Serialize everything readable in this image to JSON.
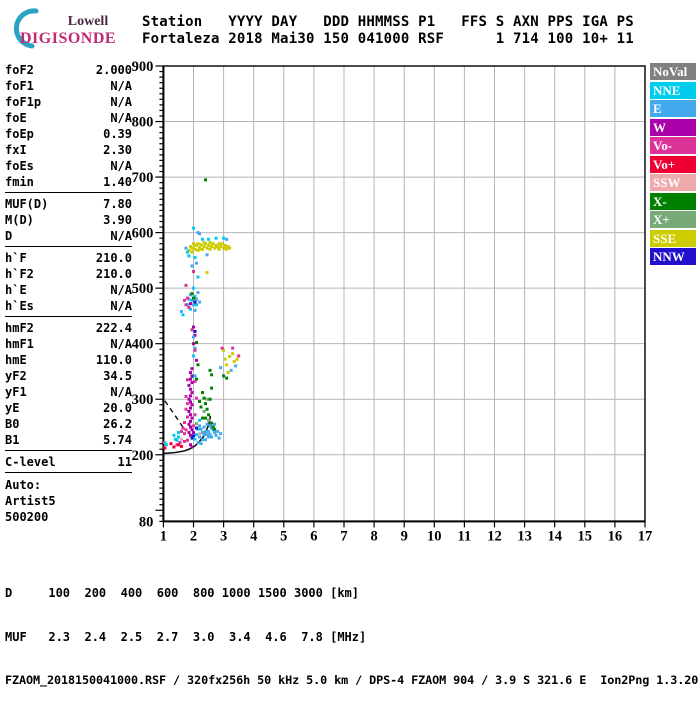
{
  "logo": {
    "top": "Lowell",
    "bottom": "DIGISONDE"
  },
  "header": {
    "line1": "Station   YYYY DAY   DDD HHMMSS P1   FFS S AXN PPS IGA PS",
    "line2": "Fortaleza 2018 Mai30 150 041000 RSF      1 714 100 10+ 11"
  },
  "params": [
    {
      "label": "foF2",
      "value": "2.000"
    },
    {
      "label": "foF1",
      "value": "N/A"
    },
    {
      "label": "foF1p",
      "value": "N/A"
    },
    {
      "label": "foE",
      "value": "N/A"
    },
    {
      "label": "foEp",
      "value": "0.39"
    },
    {
      "label": "fxI",
      "value": "2.30"
    },
    {
      "label": "foEs",
      "value": "N/A"
    },
    {
      "label": "fmin",
      "value": "1.40"
    },
    {
      "sep": true
    },
    {
      "label": "MUF(D)",
      "value": "7.80"
    },
    {
      "label": "M(D)",
      "value": "3.90"
    },
    {
      "label": "D",
      "value": "N/A"
    },
    {
      "sep": true
    },
    {
      "label": "h`F",
      "value": "210.0"
    },
    {
      "label": "h`F2",
      "value": "210.0"
    },
    {
      "label": "h`E",
      "value": "N/A"
    },
    {
      "label": "h`Es",
      "value": "N/A"
    },
    {
      "sep": true
    },
    {
      "label": "hmF2",
      "value": "222.4"
    },
    {
      "label": "hmF1",
      "value": "N/A"
    },
    {
      "label": "hmE",
      "value": "110.0"
    },
    {
      "label": "yF2",
      "value": "34.5"
    },
    {
      "label": "yF1",
      "value": "N/A"
    },
    {
      "label": "yE",
      "value": "20.0"
    },
    {
      "label": "B0",
      "value": "26.2"
    },
    {
      "label": "B1",
      "value": "5.74"
    },
    {
      "sep": true
    },
    {
      "label": "C-level",
      "value": "11"
    },
    {
      "sep": true
    }
  ],
  "auto_block": [
    "Auto:",
    "Artist5",
    "500200"
  ],
  "legend": [
    {
      "label": "NoVal",
      "color": "#808080"
    },
    {
      "label": "NNE",
      "color": "#00ccee"
    },
    {
      "label": "E",
      "color": "#44aaee"
    },
    {
      "label": "W",
      "color": "#aa00aa"
    },
    {
      "label": "Vo-",
      "color": "#dd3399"
    },
    {
      "label": "Vo+",
      "color": "#ee0033"
    },
    {
      "label": "SSW",
      "color": "#eeaaaa"
    },
    {
      "label": "X-",
      "color": "#008000"
    },
    {
      "label": "X+",
      "color": "#77aa77"
    },
    {
      "label": "SSE",
      "color": "#cccc00"
    },
    {
      "label": "NNW",
      "color": "#2211cc"
    }
  ],
  "distance_table": {
    "row1_label": "D",
    "row2_label": "MUF",
    "distances": [
      "100",
      "200",
      "400",
      "600",
      "800",
      "1000",
      "1500",
      "3000"
    ],
    "muf_values": [
      "2.3",
      "2.4",
      "2.5",
      "2.7",
      "3.0",
      "3.4",
      "4.6",
      "7.8"
    ],
    "row1_unit": "[km]",
    "row2_unit": "[MHz]"
  },
  "footer": "FZAOM_2018150041000.RSF / 320fx256h 50 kHz 5.0 km / DPS-4 FZAOM 904 / 3.9 S 321.6 E  Ion2Png 1.3.20",
  "chart_data": {
    "type": "scatter",
    "title": "",
    "x_unit": "MHz",
    "y_unit": "km",
    "x_range": [
      1,
      17
    ],
    "y_range": [
      80,
      900
    ],
    "x_ticks": [
      1,
      2,
      3,
      4,
      5,
      6,
      7,
      8,
      9,
      10,
      11,
      12,
      13,
      14,
      15,
      16,
      17
    ],
    "y_tick_labels": [
      900,
      800,
      700,
      600,
      500,
      400,
      300,
      200,
      80
    ],
    "y_gridlines": [
      200,
      300,
      400,
      500,
      600,
      700,
      800
    ],
    "grid": true,
    "legend_position": "right",
    "profile_curve": [
      [
        1.0,
        202
      ],
      [
        1.4,
        204
      ],
      [
        1.7,
        207
      ],
      [
        1.9,
        211
      ],
      [
        2.05,
        216
      ],
      [
        2.2,
        224
      ],
      [
        2.35,
        234
      ],
      [
        2.45,
        246
      ],
      [
        2.52,
        258
      ],
      [
        2.56,
        270
      ]
    ],
    "dashed_segment": [
      [
        1.05,
        297
      ],
      [
        1.7,
        246
      ]
    ],
    "points": [
      [
        1.85,
        568,
        "SSE"
      ],
      [
        1.9,
        575,
        "SSE"
      ],
      [
        1.95,
        565,
        "SSE"
      ],
      [
        1.95,
        572,
        "SSE"
      ],
      [
        2.0,
        572,
        "SSE"
      ],
      [
        2.0,
        580,
        "SSE"
      ],
      [
        2.05,
        570,
        "SSE"
      ],
      [
        2.05,
        578,
        "SSE"
      ],
      [
        2.1,
        577,
        "SSE"
      ],
      [
        2.15,
        568,
        "SSE"
      ],
      [
        2.15,
        580,
        "SSE"
      ],
      [
        2.2,
        573,
        "SSE"
      ],
      [
        2.25,
        578,
        "SSE"
      ],
      [
        2.25,
        570,
        "SSE"
      ],
      [
        2.3,
        570,
        "SSE"
      ],
      [
        2.35,
        575,
        "SSE"
      ],
      [
        2.35,
        582,
        "SSE"
      ],
      [
        2.4,
        580,
        "SSE"
      ],
      [
        2.45,
        572,
        "SSE"
      ],
      [
        2.5,
        577,
        "SSE"
      ],
      [
        2.55,
        570,
        "SSE"
      ],
      [
        2.55,
        582,
        "SSE"
      ],
      [
        2.6,
        575,
        "SSE"
      ],
      [
        2.65,
        580,
        "SSE"
      ],
      [
        2.7,
        572,
        "SSE"
      ],
      [
        2.75,
        577,
        "SSE"
      ],
      [
        2.8,
        574,
        "SSE"
      ],
      [
        2.85,
        570,
        "SSE"
      ],
      [
        2.85,
        580,
        "SSE"
      ],
      [
        2.9,
        575,
        "SSE"
      ],
      [
        2.95,
        580,
        "SSE"
      ],
      [
        3.0,
        572,
        "SSE"
      ],
      [
        3.05,
        577,
        "SSE"
      ],
      [
        3.08,
        574,
        "SSE"
      ],
      [
        3.1,
        570,
        "SSE"
      ],
      [
        3.15,
        575,
        "SSE"
      ],
      [
        3.2,
        572,
        "SSE"
      ],
      [
        1.8,
        565,
        "NNE"
      ],
      [
        1.85,
        558,
        "NNE"
      ],
      [
        2.3,
        588,
        "NNE"
      ],
      [
        2.5,
        588,
        "NNE"
      ],
      [
        2.75,
        590,
        "NNE"
      ],
      [
        3.0,
        590,
        "NNE"
      ],
      [
        2.05,
        555,
        "NNE"
      ],
      [
        2.0,
        608,
        "NNE"
      ],
      [
        1.75,
        572,
        "E"
      ],
      [
        2.2,
        598,
        "E"
      ],
      [
        2.45,
        560,
        "E"
      ],
      [
        3.1,
        588,
        "E"
      ],
      [
        2.15,
        600,
        "E"
      ],
      [
        2.4,
        695,
        "X-"
      ],
      [
        2.45,
        528,
        "SSE"
      ],
      [
        1.75,
        505,
        "Vo-"
      ],
      [
        2.0,
        530,
        "Vo-"
      ],
      [
        2.1,
        545,
        "E"
      ],
      [
        1.95,
        540,
        "E"
      ],
      [
        2.15,
        520,
        "NNE"
      ],
      [
        1.65,
        452,
        "NNE"
      ],
      [
        1.8,
        470,
        "NNE"
      ],
      [
        1.95,
        478,
        "NNE"
      ],
      [
        2.05,
        485,
        "NNE"
      ],
      [
        2.1,
        470,
        "NNE"
      ],
      [
        1.9,
        462,
        "NNE"
      ],
      [
        2.0,
        500,
        "NNE"
      ],
      [
        1.6,
        458,
        "E"
      ],
      [
        1.85,
        480,
        "E"
      ],
      [
        2.0,
        470,
        "E"
      ],
      [
        2.1,
        480,
        "E"
      ],
      [
        2.15,
        492,
        "E"
      ],
      [
        1.9,
        488,
        "E"
      ],
      [
        2.2,
        475,
        "E"
      ],
      [
        2.05,
        460,
        "E"
      ],
      [
        1.75,
        470,
        "Vo-"
      ],
      [
        1.8,
        482,
        "Vo-"
      ],
      [
        1.85,
        465,
        "Vo-"
      ],
      [
        1.7,
        478,
        "Vo-"
      ],
      [
        1.95,
        490,
        "X-"
      ],
      [
        2.0,
        482,
        "X-"
      ],
      [
        1.9,
        472,
        "W"
      ],
      [
        2.05,
        475,
        "NNW"
      ],
      [
        2.0,
        430,
        "W"
      ],
      [
        2.05,
        415,
        "W"
      ],
      [
        2.0,
        400,
        "W"
      ],
      [
        2.1,
        370,
        "W"
      ],
      [
        1.95,
        355,
        "W"
      ],
      [
        2.0,
        412,
        "E"
      ],
      [
        2.05,
        392,
        "E"
      ],
      [
        1.95,
        340,
        "E"
      ],
      [
        2.0,
        378,
        "NNE"
      ],
      [
        2.05,
        342,
        "NNE"
      ],
      [
        2.1,
        402,
        "X-"
      ],
      [
        2.15,
        362,
        "X-"
      ],
      [
        2.1,
        336,
        "X-"
      ],
      [
        2.05,
        388,
        "Vo-"
      ],
      [
        1.95,
        425,
        "Vo-"
      ],
      [
        2.05,
        422,
        "NNW"
      ],
      [
        3.0,
        388,
        "SSE"
      ],
      [
        3.05,
        372,
        "SSE"
      ],
      [
        3.1,
        362,
        "SSE"
      ],
      [
        3.2,
        377,
        "SSE"
      ],
      [
        3.3,
        382,
        "SSE"
      ],
      [
        3.35,
        368,
        "SSE"
      ],
      [
        3.15,
        348,
        "SSE"
      ],
      [
        3.45,
        372,
        "SSE"
      ],
      [
        3.3,
        392,
        "Vo-"
      ],
      [
        2.95,
        392,
        "Vo-"
      ],
      [
        3.5,
        378,
        "Vo-"
      ],
      [
        2.9,
        357,
        "E"
      ],
      [
        3.25,
        352,
        "E"
      ],
      [
        3.4,
        360,
        "E"
      ],
      [
        3.1,
        338,
        "X-"
      ],
      [
        3.0,
        342,
        "X-"
      ],
      [
        1.9,
        348,
        "W"
      ],
      [
        1.95,
        342,
        "W"
      ],
      [
        1.9,
        336,
        "W"
      ],
      [
        1.95,
        330,
        "W"
      ],
      [
        1.85,
        325,
        "W"
      ],
      [
        1.9,
        318,
        "W"
      ],
      [
        1.95,
        312,
        "W"
      ],
      [
        1.9,
        306,
        "W"
      ],
      [
        1.85,
        300,
        "W"
      ],
      [
        1.9,
        295,
        "W"
      ],
      [
        1.95,
        290,
        "W"
      ],
      [
        1.9,
        284,
        "W"
      ],
      [
        1.85,
        278,
        "W"
      ],
      [
        1.9,
        272,
        "W"
      ],
      [
        1.95,
        266,
        "W"
      ],
      [
        1.9,
        260,
        "W"
      ],
      [
        1.85,
        255,
        "W"
      ],
      [
        1.9,
        250,
        "W"
      ],
      [
        1.95,
        245,
        "W"
      ],
      [
        2.0,
        240,
        "W"
      ],
      [
        1.85,
        240,
        "W"
      ],
      [
        1.9,
        235,
        "W"
      ],
      [
        1.9,
        218,
        "W"
      ],
      [
        1.95,
        214,
        "W"
      ],
      [
        1.8,
        335,
        "Vo-"
      ],
      [
        1.75,
        305,
        "Vo-"
      ],
      [
        1.8,
        292,
        "Vo-"
      ],
      [
        1.75,
        282,
        "Vo-"
      ],
      [
        1.8,
        268,
        "Vo-"
      ],
      [
        1.7,
        258,
        "Vo-"
      ],
      [
        2.05,
        332,
        "Vo-"
      ],
      [
        2.1,
        302,
        "Vo-"
      ],
      [
        2.05,
        272,
        "Vo-"
      ],
      [
        2.0,
        252,
        "Vo-"
      ],
      [
        1.65,
        248,
        "Vo-"
      ],
      [
        1.6,
        242,
        "Vo-"
      ],
      [
        1.75,
        245,
        "Vo-"
      ],
      [
        1.7,
        238,
        "Vo-"
      ],
      [
        1.55,
        222,
        "Vo-"
      ],
      [
        1.7,
        224,
        "Vo-"
      ],
      [
        1.8,
        226,
        "Vo-"
      ],
      [
        1.45,
        218,
        "Vo-"
      ],
      [
        1.0,
        222,
        "Vo+"
      ],
      [
        1.25,
        220,
        "Vo+"
      ],
      [
        1.05,
        212,
        "Vo+"
      ],
      [
        1.5,
        218,
        "Vo+"
      ],
      [
        1.6,
        215,
        "Vo+"
      ],
      [
        1.35,
        214,
        "Vo+"
      ],
      [
        1.35,
        235,
        "NNE"
      ],
      [
        1.4,
        228,
        "NNE"
      ],
      [
        1.5,
        240,
        "NNE"
      ],
      [
        1.05,
        222,
        "NNE"
      ],
      [
        1.1,
        218,
        "NNE"
      ],
      [
        2.1,
        236,
        "NNE"
      ],
      [
        2.15,
        246,
        "NNE"
      ],
      [
        2.2,
        262,
        "NNE"
      ],
      [
        2.05,
        228,
        "NNE"
      ],
      [
        1.5,
        232,
        "NNE"
      ],
      [
        1.45,
        226,
        "NNE"
      ],
      [
        2.2,
        252,
        "E"
      ],
      [
        2.25,
        246,
        "E"
      ],
      [
        2.3,
        240,
        "E"
      ],
      [
        2.35,
        236,
        "E"
      ],
      [
        2.4,
        242,
        "E"
      ],
      [
        2.45,
        236,
        "E"
      ],
      [
        2.5,
        232,
        "E"
      ],
      [
        2.3,
        227,
        "E"
      ],
      [
        2.2,
        232,
        "E"
      ],
      [
        2.15,
        222,
        "E"
      ],
      [
        2.25,
        220,
        "E"
      ],
      [
        2.4,
        227,
        "E"
      ],
      [
        2.5,
        242,
        "E"
      ],
      [
        2.55,
        237,
        "E"
      ],
      [
        2.6,
        232,
        "E"
      ],
      [
        2.35,
        250,
        "E"
      ],
      [
        2.45,
        255,
        "E"
      ],
      [
        2.65,
        245,
        "E"
      ],
      [
        2.7,
        240,
        "E"
      ],
      [
        2.75,
        235,
        "E"
      ],
      [
        2.8,
        242,
        "E"
      ],
      [
        2.9,
        238,
        "E"
      ],
      [
        2.85,
        230,
        "E"
      ],
      [
        2.7,
        255,
        "E"
      ],
      [
        2.6,
        248,
        "E"
      ],
      [
        2.55,
        252,
        "E"
      ],
      [
        2.3,
        312,
        "X-"
      ],
      [
        2.35,
        302,
        "X-"
      ],
      [
        2.4,
        292,
        "X-"
      ],
      [
        2.45,
        282,
        "X-"
      ],
      [
        2.5,
        272,
        "X-"
      ],
      [
        2.3,
        266,
        "X-"
      ],
      [
        2.6,
        257,
        "X-"
      ],
      [
        2.65,
        250,
        "X-"
      ],
      [
        2.7,
        246,
        "X-"
      ],
      [
        2.4,
        266,
        "X-"
      ],
      [
        2.2,
        296,
        "X-"
      ],
      [
        2.25,
        286,
        "X-"
      ],
      [
        2.55,
        300,
        "X-"
      ],
      [
        2.6,
        320,
        "X-"
      ],
      [
        2.55,
        352,
        "X-"
      ],
      [
        2.6,
        344,
        "X-"
      ],
      [
        2.5,
        262,
        "X+"
      ],
      [
        2.1,
        256,
        "X+"
      ],
      [
        2.45,
        300,
        "X+"
      ],
      [
        2.35,
        278,
        "X+"
      ],
      [
        2.0,
        234,
        "NNW"
      ],
      [
        1.95,
        230,
        "NNW"
      ],
      [
        2.1,
        248,
        "NNW"
      ],
      [
        2.2,
        238,
        "SSW"
      ],
      [
        1.6,
        228,
        "SSW"
      ]
    ]
  }
}
